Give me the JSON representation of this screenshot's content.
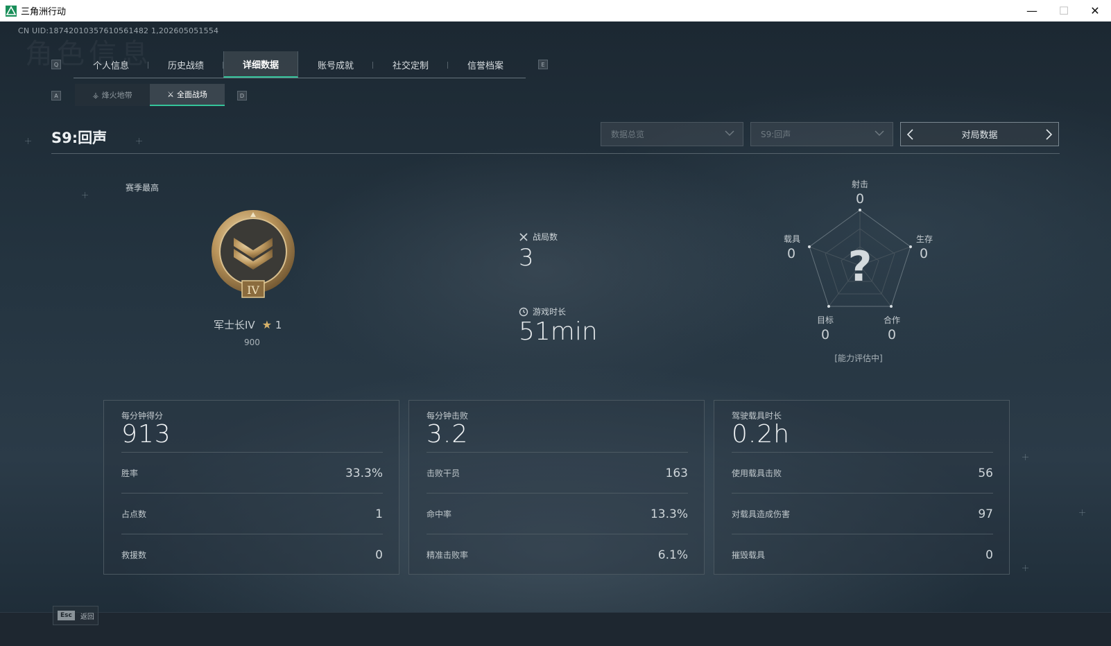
{
  "window": {
    "title": "三角洲行动",
    "minimize_glyph": "—",
    "maximize_glyph": "☐",
    "close_glyph": "✕"
  },
  "uid_text": "CN UID:18742010357610561482 1,202605051554",
  "watermark": "角色信息",
  "keys": {
    "prev_tab": "Q",
    "next_tab": "E",
    "prev_sub": "A",
    "next_sub": "D"
  },
  "main_tabs": [
    {
      "label": "个人信息"
    },
    {
      "label": "历史战绩"
    },
    {
      "label": "详细数据"
    },
    {
      "label": "账号成就"
    },
    {
      "label": "社交定制"
    },
    {
      "label": "信誉档案"
    }
  ],
  "sub_tabs": [
    {
      "label": "烽火地带"
    },
    {
      "label": "全面战场"
    }
  ],
  "season_title": "S9:回声",
  "filters": {
    "dropdown1": "数据总览",
    "dropdown2": "S9:回声",
    "selector": "对局数据"
  },
  "rank": {
    "section_label": "赛季最高",
    "name": "军士长IV",
    "star_glyph": "★",
    "stars": "1",
    "score": "900",
    "badge_numeral": "IV"
  },
  "summary": {
    "matches_label": "战局数",
    "matches_value": "3",
    "playtime_label": "游戏时长",
    "playtime_value": "51min"
  },
  "radar": {
    "center_glyph": "?",
    "shooting_label": "射击",
    "shooting_value": "0",
    "survival_label": "生存",
    "survival_value": "0",
    "teamwork_label": "合作",
    "teamwork_value": "0",
    "objective_label": "目标",
    "objective_value": "0",
    "vehicle_label": "载具",
    "vehicle_value": "0",
    "status": "[能力评估中]"
  },
  "cards": [
    {
      "head_label": "每分钟得分",
      "head_value": "913",
      "rows": [
        {
          "label": "胜率",
          "value": "33.3%"
        },
        {
          "label": "占点数",
          "value": "1"
        },
        {
          "label": "救援数",
          "value": "0"
        }
      ]
    },
    {
      "head_label": "每分钟击败",
      "head_value": "3.2",
      "rows": [
        {
          "label": "击败干员",
          "value": "163"
        },
        {
          "label": "命中率",
          "value": "13.3%"
        },
        {
          "label": "精准击败率",
          "value": "6.1%"
        }
      ]
    },
    {
      "head_label": "驾驶载具时长",
      "head_value": "0.2h",
      "rows": [
        {
          "label": "使用载具击败",
          "value": "56"
        },
        {
          "label": "对载具造成伤害",
          "value": "97"
        },
        {
          "label": "摧毁载具",
          "value": "0"
        }
      ]
    }
  ],
  "footer": {
    "esc_key": "Esc",
    "back_label": "返回"
  },
  "colors": {
    "accent": "#35c49a",
    "gold": "#d7b26a",
    "background": "#1b2630"
  }
}
